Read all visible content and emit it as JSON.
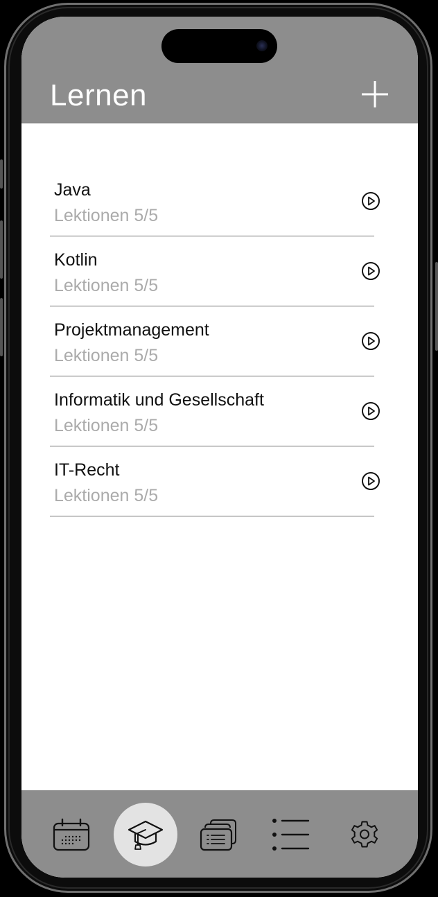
{
  "header": {
    "title": "Lernen",
    "add_icon": "plus-icon"
  },
  "courses": [
    {
      "name": "Java",
      "progress": "Lektionen 5/5",
      "action_icon": "play-circle-icon"
    },
    {
      "name": "Kotlin",
      "progress": "Lektionen 5/5",
      "action_icon": "play-circle-icon"
    },
    {
      "name": "Projektmanagement",
      "progress": "Lektionen 5/5",
      "action_icon": "play-circle-icon"
    },
    {
      "name": "Informatik und Gesellschaft",
      "progress": "Lektionen 5/5",
      "action_icon": "play-circle-icon"
    },
    {
      "name": "IT-Recht",
      "progress": "Lektionen 5/5",
      "action_icon": "play-circle-icon"
    }
  ],
  "tabbar": {
    "tabs": [
      {
        "id": "calendar",
        "icon": "calendar-icon",
        "active": false
      },
      {
        "id": "learn",
        "icon": "graduation-cap-icon",
        "active": true
      },
      {
        "id": "cards",
        "icon": "flashcards-icon",
        "active": false
      },
      {
        "id": "list",
        "icon": "list-icon",
        "active": false
      },
      {
        "id": "settings",
        "icon": "gear-icon",
        "active": false
      }
    ]
  },
  "colors": {
    "bar_gray": "#8d8d8d",
    "active_tab_bg": "#e3e3e3",
    "subtitle_gray": "#ababab",
    "background": "#ffffff"
  }
}
